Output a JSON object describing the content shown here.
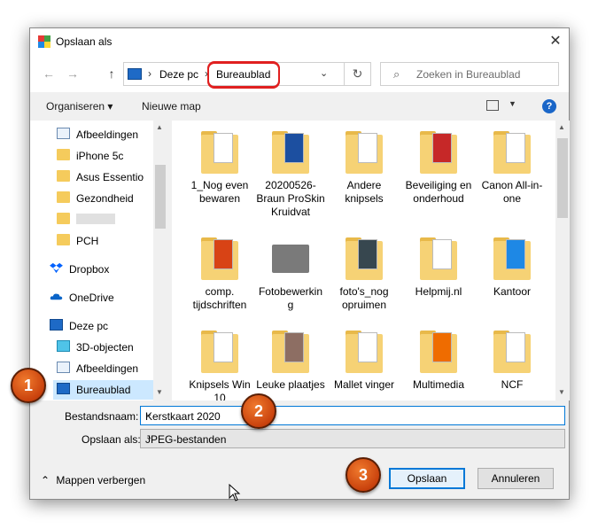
{
  "window": {
    "title": "Opslaan als",
    "close": "✕"
  },
  "nav": {
    "back": "←",
    "forward": "→",
    "up": "↑",
    "breadcrumb": [
      "Deze pc",
      "Bureaublad"
    ],
    "separator": "›",
    "refresh": "↻",
    "search_placeholder": "Zoeken in Bureaublad"
  },
  "toolbar": {
    "organise": "Organiseren ▾",
    "new_folder": "Nieuwe map",
    "help": "?"
  },
  "sidebar": {
    "items": [
      {
        "label": "Afbeeldingen",
        "icon": "pictures-icon",
        "pinned": true
      },
      {
        "label": "iPhone 5c",
        "icon": "folder-icon",
        "pinned": true
      },
      {
        "label": "Asus Essentio",
        "icon": "folder-icon",
        "pinned": false
      },
      {
        "label": "Gezondheid",
        "icon": "folder-icon",
        "pinned": false
      },
      {
        "label": "",
        "icon": "folder-icon",
        "pinned": false
      },
      {
        "label": "PCH",
        "icon": "folder-icon",
        "pinned": false
      },
      {
        "label": "Dropbox",
        "icon": "dropbox-icon",
        "pinned": false
      },
      {
        "label": "OneDrive",
        "icon": "onedrive-icon",
        "pinned": false
      },
      {
        "label": "Deze pc",
        "icon": "pc-icon",
        "pinned": false
      },
      {
        "label": "3D-objecten",
        "icon": "3d-objects-icon",
        "pinned": false
      },
      {
        "label": "Afbeeldingen",
        "icon": "pictures-icon",
        "pinned": false
      },
      {
        "label": "Bureaublad",
        "icon": "desktop-icon",
        "pinned": false,
        "selected": true
      }
    ]
  },
  "files": [
    {
      "name": "1_Nog even bewaren"
    },
    {
      "name": "20200526-Braun ProSkin Kruidvat"
    },
    {
      "name": "Andere knipsels"
    },
    {
      "name": "Beveiliging en onderhoud"
    },
    {
      "name": "Canon All-in-one"
    },
    {
      "name": "comp. tijdschriften"
    },
    {
      "name": "Fotobewerking"
    },
    {
      "name": "foto's_nog opruimen"
    },
    {
      "name": "Helpmij.nl"
    },
    {
      "name": "Kantoor"
    },
    {
      "name": "Knipsels Win 10"
    },
    {
      "name": "Leuke plaatjes"
    },
    {
      "name": "Mallet vinger"
    },
    {
      "name": "Multimedia"
    },
    {
      "name": "NCF"
    }
  ],
  "form": {
    "filename_label": "Bestandsnaam:",
    "filename_value": "Kerstkaart 2020",
    "type_label": "Opslaan als:",
    "type_value": "JPEG-bestanden"
  },
  "footer": {
    "hide_folders": "Mappen verbergen",
    "save": "Opslaan",
    "cancel": "Annuleren"
  },
  "badges": [
    "1",
    "2",
    "3"
  ],
  "colors": {
    "accent": "#0078d7",
    "badge": "#d4521a",
    "highlight_ring": "#e02020",
    "folder": "#f6d275"
  }
}
